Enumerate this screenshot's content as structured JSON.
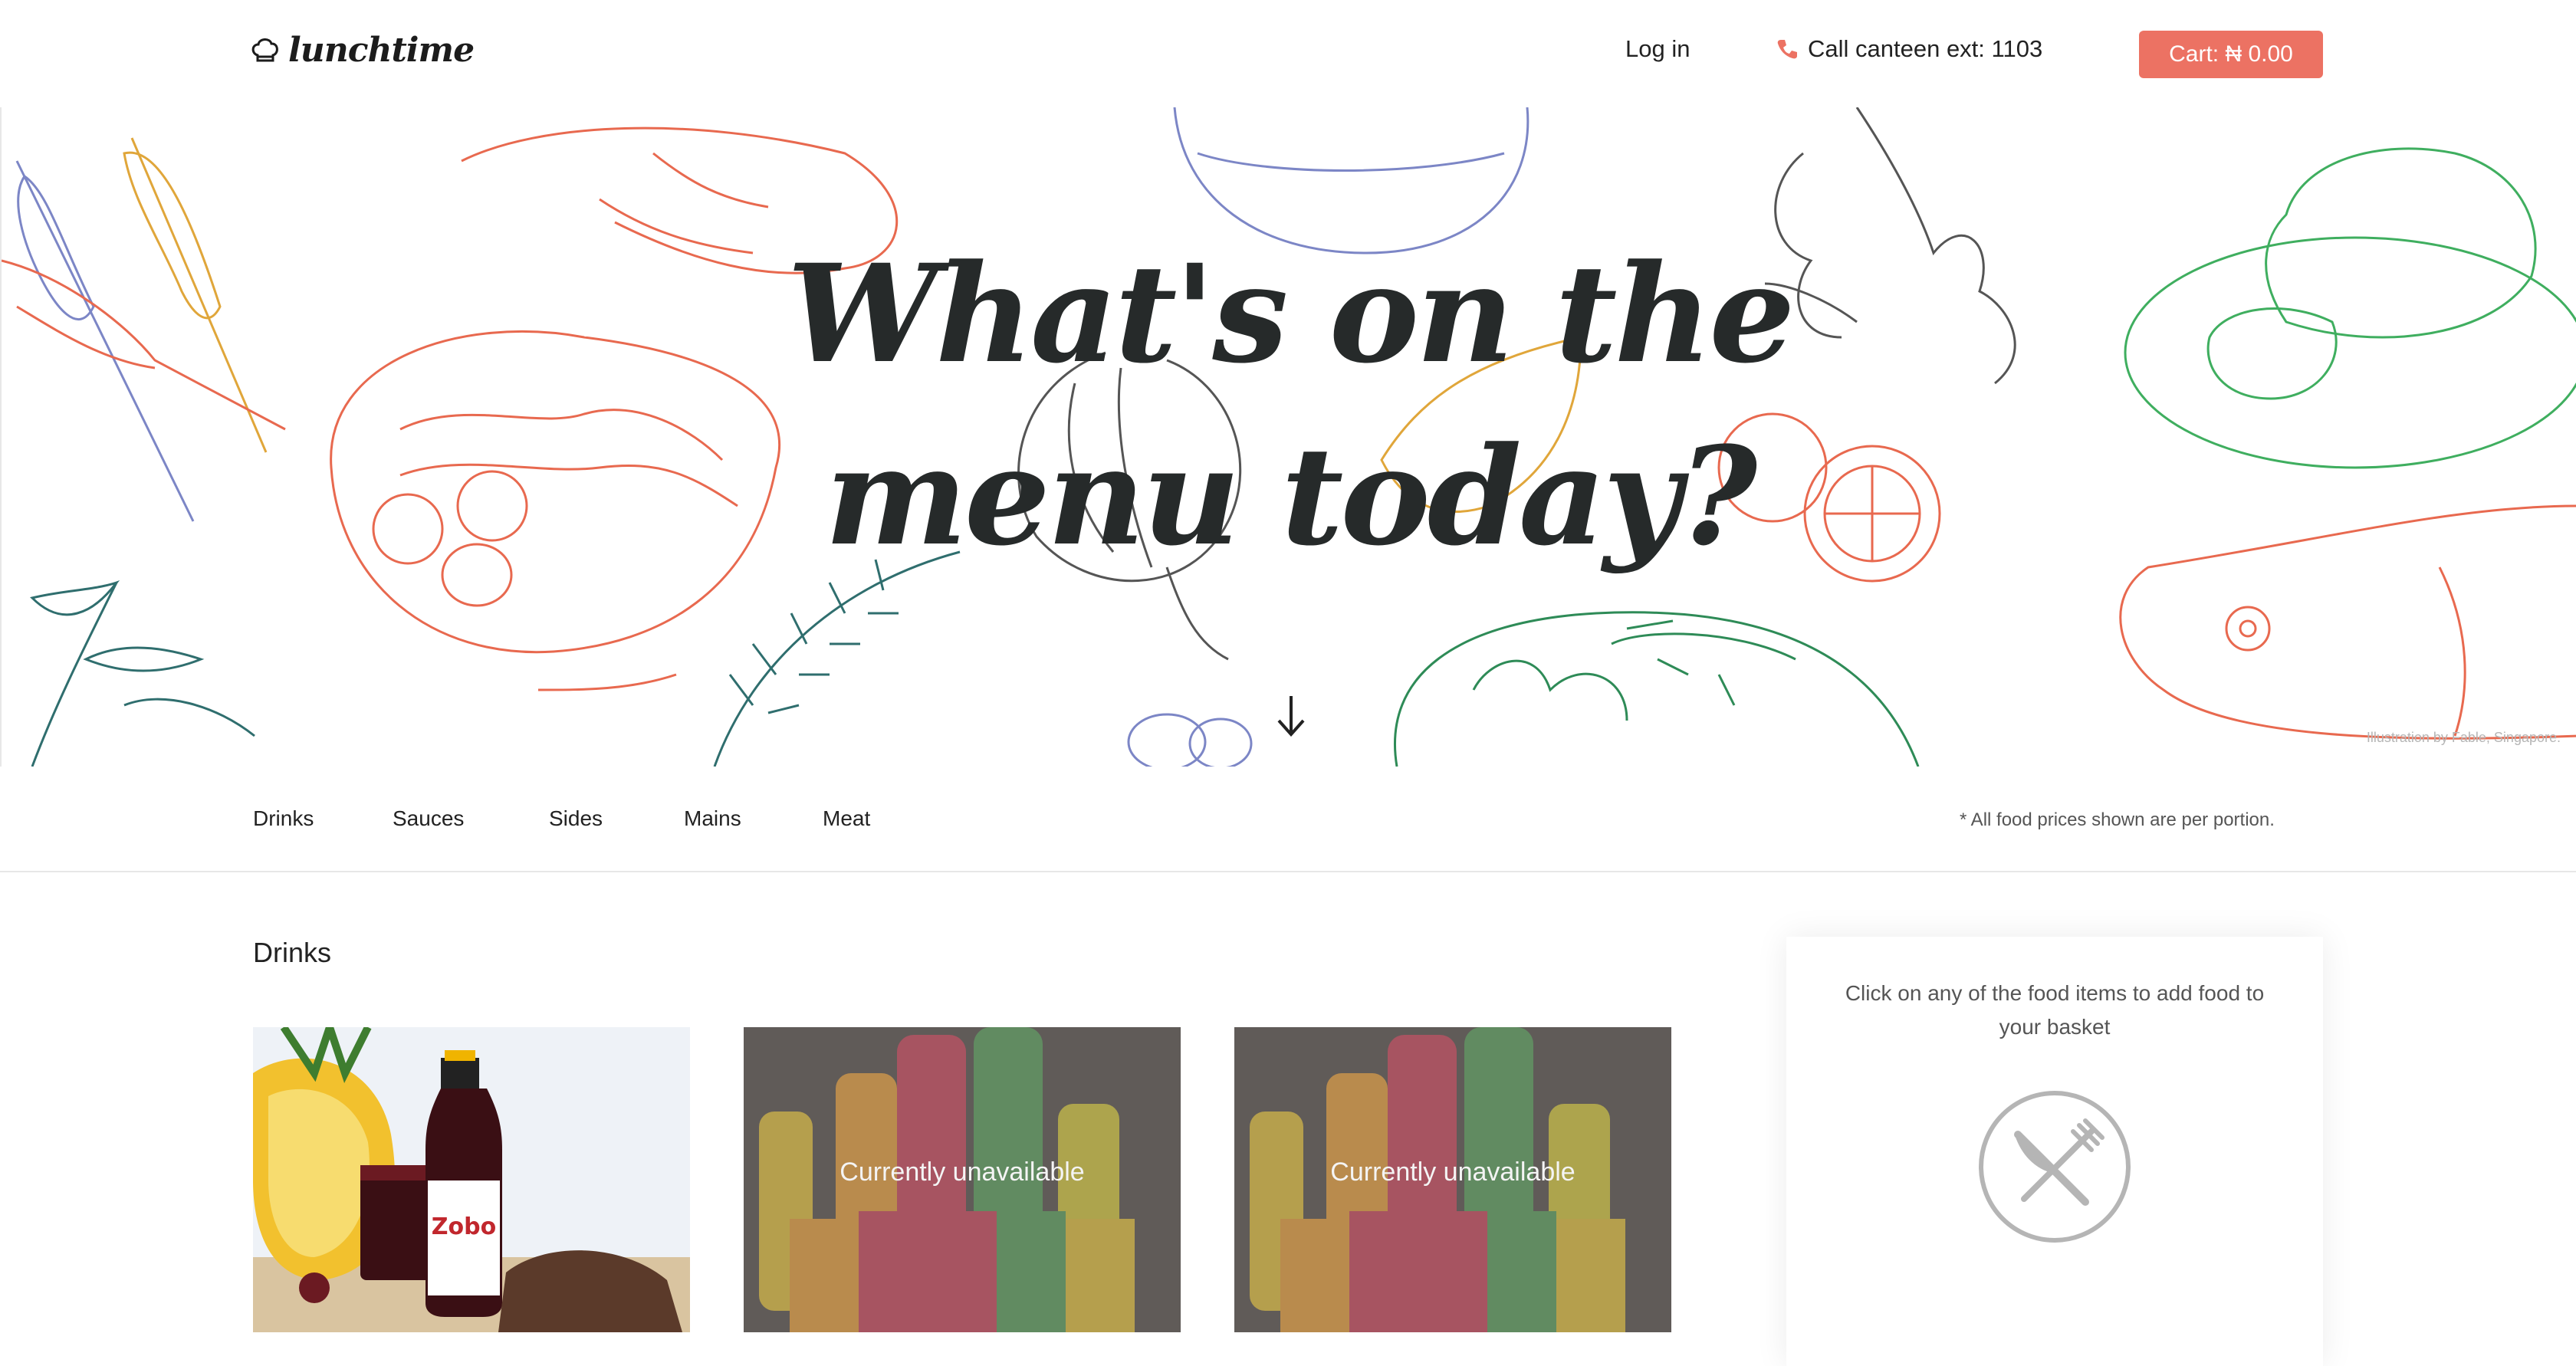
{
  "header": {
    "logo_text": "lunchtime",
    "login_label": "Log in",
    "call_label": "Call canteen ext: 1103",
    "cart_label": "Cart: ₦ 0.00"
  },
  "hero": {
    "title_line1": "What's on the",
    "title_line2": "menu today?",
    "illustration_credit": "Illustration by Fable, Singapore."
  },
  "categories": [
    "Drinks",
    "Sauces",
    "Sides",
    "Mains",
    "Meat"
  ],
  "price_note": "* All food prices shown are per portion.",
  "section": {
    "title": "Drinks",
    "items": [
      {
        "status": ""
      },
      {
        "status": "Currently unavailable"
      },
      {
        "status": "Currently unavailable"
      }
    ]
  },
  "basket": {
    "message": "Click on any of the food items to add food to your basket"
  },
  "colors": {
    "accent": "#ec7263",
    "text": "#262a2a",
    "doodle_orange": "#e8694f",
    "doodle_green": "#3fae5f",
    "doodle_blue": "#7c86c6",
    "doodle_yellow": "#e0a63a"
  }
}
